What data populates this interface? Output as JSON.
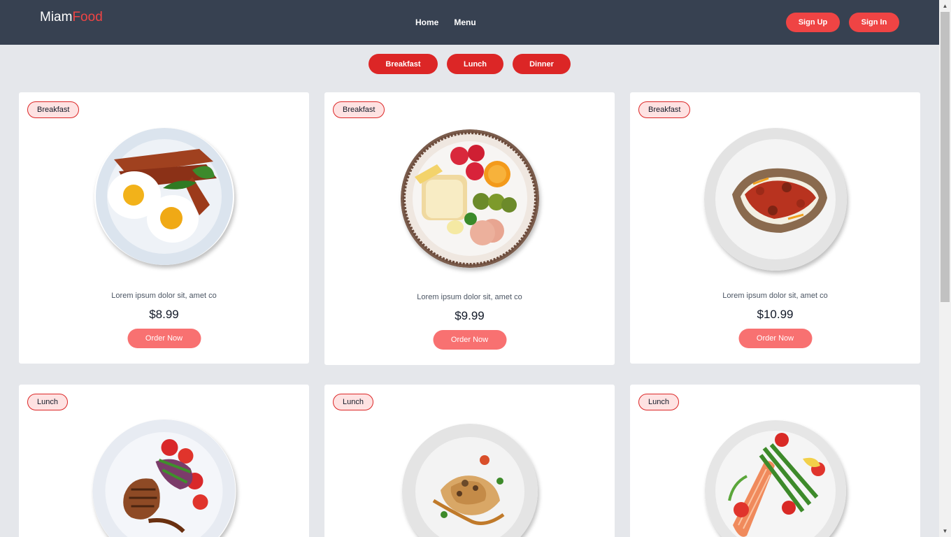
{
  "brand": {
    "part1": "Miam",
    "part2": "Food"
  },
  "nav": {
    "home": "Home",
    "menu": "Menu"
  },
  "auth": {
    "signup": "Sign Up",
    "signin": "Sign In"
  },
  "filters": {
    "breakfast": "Breakfast",
    "lunch": "Lunch",
    "dinner": "Dinner"
  },
  "cards": [
    {
      "tag": "Breakfast",
      "dish": "fried-eggs-bacon",
      "description": "Lorem ipsum dolor sit, amet co",
      "price": "$8.99",
      "button": "Order Now"
    },
    {
      "tag": "Breakfast",
      "dish": "bread-fruit-plate",
      "description": "Lorem ipsum dolor sit, amet co",
      "price": "$9.99",
      "button": "Order Now"
    },
    {
      "tag": "Breakfast",
      "dish": "loaded-baked-potato",
      "description": "Lorem ipsum dolor sit, amet co",
      "price": "$10.99",
      "button": "Order Now"
    },
    {
      "tag": "Lunch",
      "dish": "grilled-meat-vegetables"
    },
    {
      "tag": "Lunch",
      "dish": "chicken-sauce"
    },
    {
      "tag": "Lunch",
      "dish": "salmon-asparagus"
    }
  ],
  "colors": {
    "navbar": "#374151",
    "accent": "#ef4444",
    "filter": "#dc2626",
    "order_button": "#f87171",
    "background": "#e5e7eb",
    "tag_background": "#fee2e2"
  }
}
